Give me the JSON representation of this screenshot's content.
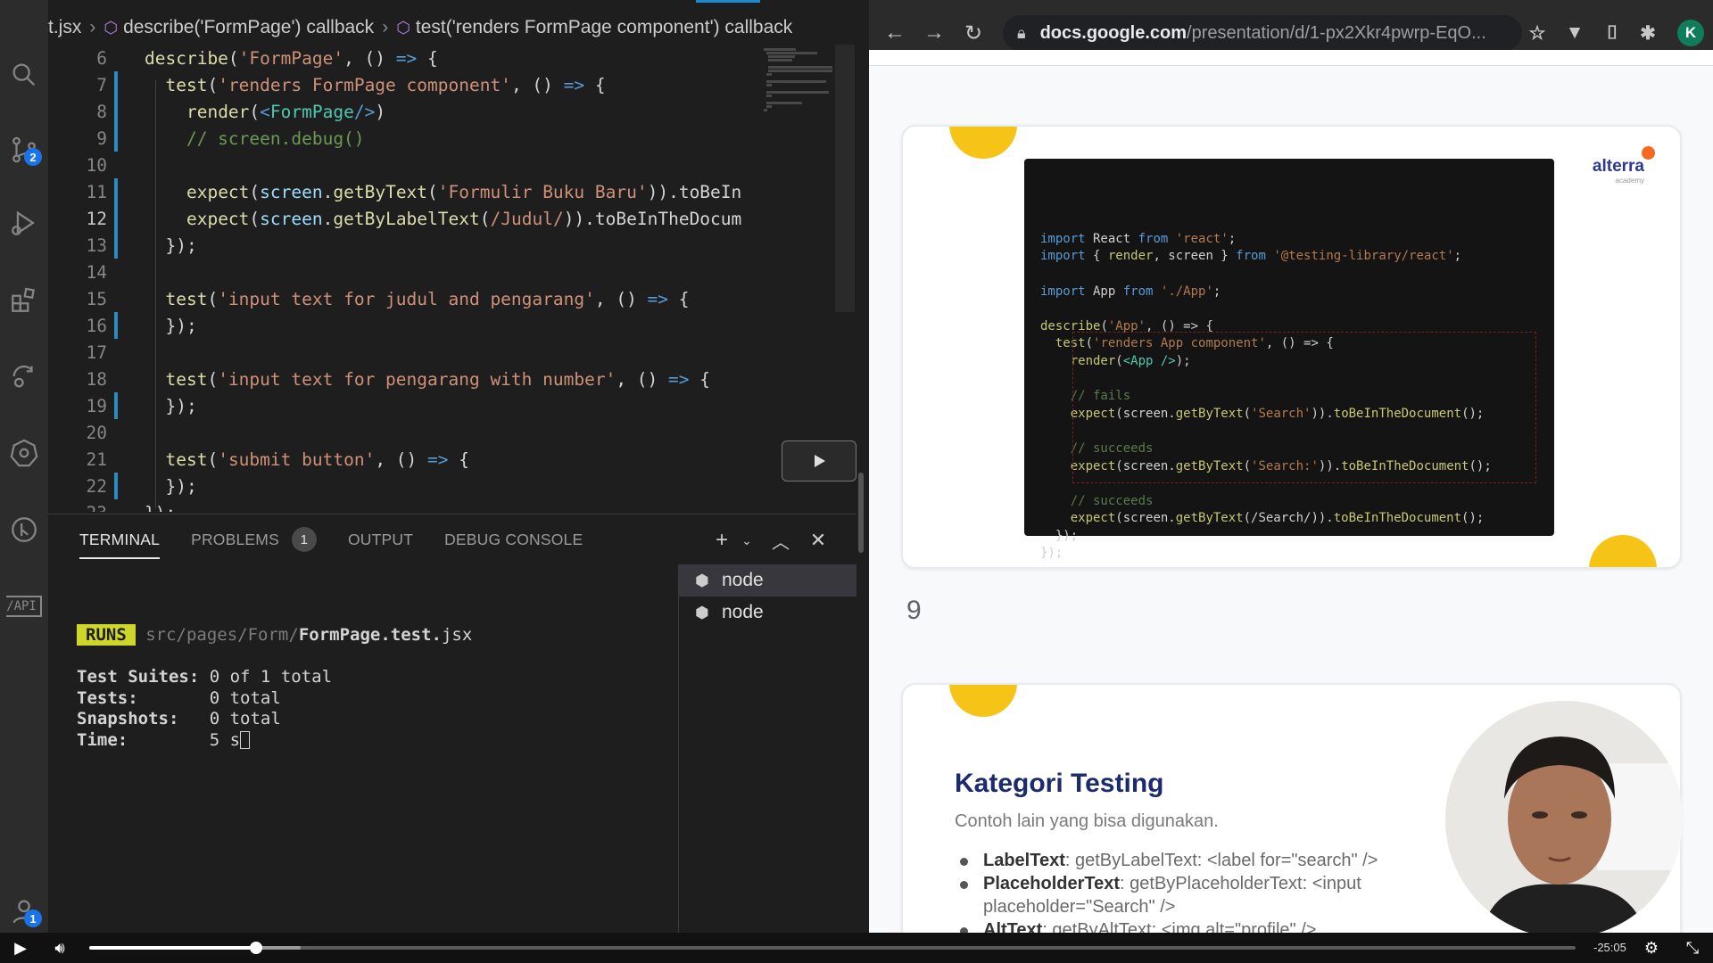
{
  "vscode": {
    "breadcrumb": {
      "file": "t.jsx",
      "describe": "describe('FormPage') callback",
      "test": "test('renders FormPage component') callback"
    },
    "source_control_badge": "2",
    "accounts_badge": "1",
    "api_label": "/API",
    "code_lines": [
      {
        "num": "6",
        "text": "describe('FormPage', () => {"
      },
      {
        "num": "7",
        "text": "  test('renders FormPage component', () => {"
      },
      {
        "num": "8",
        "text": "    render(<FormPage/>)"
      },
      {
        "num": "9",
        "text": "    // screen.debug()"
      },
      {
        "num": "10",
        "text": ""
      },
      {
        "num": "11",
        "text": "    expect(screen.getByText('Formulir Buku Baru')).toBeIn"
      },
      {
        "num": "12",
        "text": "    expect(screen.getByLabelText(/Judul/)).toBeInTheDocum"
      },
      {
        "num": "13",
        "text": "  });"
      },
      {
        "num": "14",
        "text": ""
      },
      {
        "num": "15",
        "text": "  test('input text for judul and pengarang', () => {"
      },
      {
        "num": "16",
        "text": "  });"
      },
      {
        "num": "17",
        "text": ""
      },
      {
        "num": "18",
        "text": "  test('input text for pengarang with number', () => {"
      },
      {
        "num": "19",
        "text": "  });"
      },
      {
        "num": "20",
        "text": ""
      },
      {
        "num": "21",
        "text": "  test('submit button', () => {"
      },
      {
        "num": "22",
        "text": "  });"
      },
      {
        "num": "23",
        "text": "});"
      }
    ],
    "panel": {
      "tabs": [
        "TERMINAL",
        "PROBLEMS",
        "OUTPUT",
        "DEBUG CONSOLE"
      ],
      "problems_count": "1",
      "terminals": [
        "node",
        "node"
      ],
      "runs_badge": "RUNS",
      "runs_path_dim": "src/pages/Form/",
      "runs_file": "FormPage.test.",
      "runs_ext": "jsx",
      "summary": [
        {
          "label": "Test Suites:",
          "value": "0 of 1 total"
        },
        {
          "label": "Tests:",
          "value": "0 total"
        },
        {
          "label": "Snapshots:",
          "value": "0 total"
        },
        {
          "label": "Time:",
          "value": "5 s"
        }
      ]
    }
  },
  "browser": {
    "url_domain": "docs.google.com",
    "url_rest": "/presentation/d/1-px2Xkr4pwrp-EqO...",
    "profile_initial": "K",
    "slide1": {
      "logo": "alterra",
      "logo_sub": "academy",
      "code": [
        "import React from 'react';",
        "import { render, screen } from '@testing-library/react';",
        "",
        "import App from './App';",
        "",
        "describe('App', () => {",
        "  test('renders App component', () => {",
        "    render(<App />);",
        "",
        "    // fails",
        "    expect(screen.getByText('Search')).toBeInTheDocument();",
        "",
        "    // succeeds",
        "    expect(screen.getByText('Search:')).toBeInTheDocument();",
        "",
        "    // succeeds",
        "    expect(screen.getByText(/Search/)).toBeInTheDocument();",
        "  });",
        "});"
      ]
    },
    "slide_number": "9",
    "slide2": {
      "title": "Kategori Testing",
      "subtitle": "Contoh lain yang bisa digunakan.",
      "items": [
        {
          "bold": "LabelText",
          "text": ": getByLabelText: <label for=\"search\" />"
        },
        {
          "bold": "PlaceholderText",
          "text": ": getByPlaceholderText: <input placeholder=\"Search\" />"
        },
        {
          "bold": "AltText",
          "text": ": getByAltText: <img alt=\"profile\" />"
        }
      ]
    }
  },
  "player": {
    "time_remaining": "-25:05",
    "progress": 0.112,
    "buffered": 0.142
  }
}
